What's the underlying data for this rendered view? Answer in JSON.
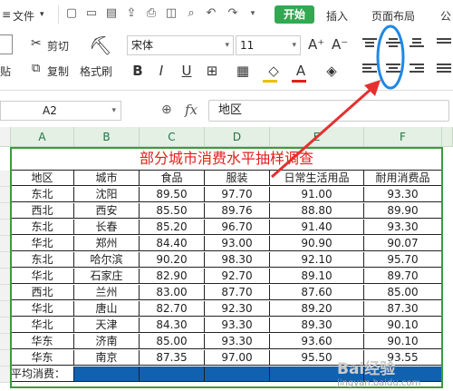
{
  "menu": {
    "file_label": "文件",
    "start_label": "开始",
    "insert_label": "插入",
    "layout_label": "页面布局",
    "formula_label": "公"
  },
  "toolbar": {
    "cut_label": "剪切",
    "copy_label": "复制",
    "paste_label": "贴",
    "format_painter_label": "格式刷",
    "font_name": "宋体",
    "font_size": "11"
  },
  "formula_bar": {
    "cell_ref": "A2",
    "fx_label": "fx",
    "content": "地区"
  },
  "sheet": {
    "columns": [
      "A",
      "B",
      "C",
      "D",
      "E",
      "F"
    ],
    "title": "部分城市消费水平抽样调查",
    "headers": [
      "地区",
      "城市",
      "食品",
      "服装",
      "日常生活用品",
      "耐用消费品"
    ],
    "rows": [
      [
        "东北",
        "沈阳",
        "89.50",
        "97.70",
        "91.00",
        "93.30"
      ],
      [
        "西北",
        "西安",
        "85.50",
        "89.76",
        "88.80",
        "89.90"
      ],
      [
        "东北",
        "长春",
        "85.20",
        "96.70",
        "91.40",
        "93.30"
      ],
      [
        "华北",
        "郑州",
        "84.40",
        "93.00",
        "90.90",
        "90.07"
      ],
      [
        "东北",
        "哈尔滨",
        "90.20",
        "98.30",
        "92.10",
        "95.70"
      ],
      [
        "华北",
        "石家庄",
        "82.90",
        "92.70",
        "89.10",
        "89.70"
      ],
      [
        "西北",
        "兰州",
        "83.00",
        "87.70",
        "87.60",
        "85.00"
      ],
      [
        "华北",
        "唐山",
        "82.70",
        "92.30",
        "89.20",
        "87.30"
      ],
      [
        "华北",
        "天津",
        "84.30",
        "93.30",
        "89.30",
        "90.10"
      ],
      [
        "华东",
        "济南",
        "85.00",
        "93.30",
        "93.60",
        "90.10"
      ],
      [
        "华东",
        "南京",
        "87.35",
        "97.00",
        "95.50",
        "93.55"
      ]
    ],
    "avg_label": "平均消费："
  },
  "watermark": "jingyan.baidu.com",
  "colors": {
    "accent_green": "#33a852",
    "title_red": "#e0201b",
    "selection_blue": "#1061b0",
    "annotation_red": "#e53030",
    "annotation_blue": "#1e88e5"
  }
}
